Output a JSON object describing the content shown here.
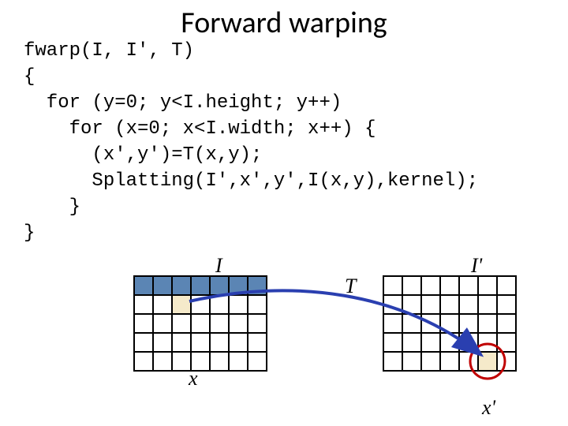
{
  "title": "Forward warping",
  "code": {
    "l1": "fwarp(I, I', T)",
    "l2": "{",
    "l3": "  for (y=0; y<I.height; y++)",
    "l4": "    for (x=0; x<I.width; x++) {",
    "l5": "      (x',y')=T(x,y);",
    "l6": "      Splatting(I',x',y',I(x,y),kernel);",
    "l7": "    }",
    "l8": "}"
  },
  "labels": {
    "I": "I",
    "Iprime": "I'",
    "T": "T",
    "x": "x",
    "xprime": "x'"
  },
  "colors": {
    "scanline": "#5b85b4",
    "highlight": "#f5eaca",
    "arrow": "#2a3fb0",
    "circle": "#c00000"
  }
}
